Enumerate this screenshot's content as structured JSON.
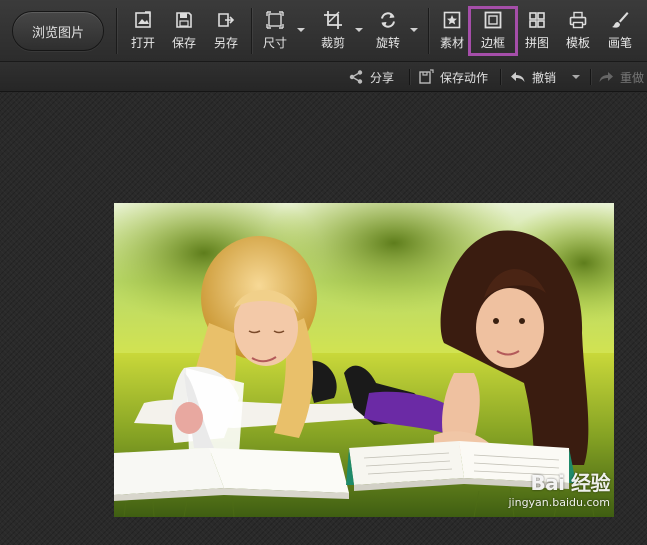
{
  "toolbar": {
    "browse_label": "浏览图片",
    "tools": [
      {
        "label": "打开"
      },
      {
        "label": "保存"
      },
      {
        "label": "另存"
      },
      {
        "label": "尺寸"
      },
      {
        "label": "裁剪"
      },
      {
        "label": "旋转"
      },
      {
        "label": "素材"
      },
      {
        "label": "边框"
      },
      {
        "label": "拼图"
      },
      {
        "label": "模板"
      },
      {
        "label": "画笔"
      }
    ],
    "highlight_color": "#a54ea9"
  },
  "subbar": {
    "share": "分享",
    "save_action": "保存动作",
    "undo": "撤销",
    "redo": "重做"
  },
  "photo": {
    "watermark_logo": "Bai 经验",
    "watermark_url": "jingyan.baidu.com"
  }
}
